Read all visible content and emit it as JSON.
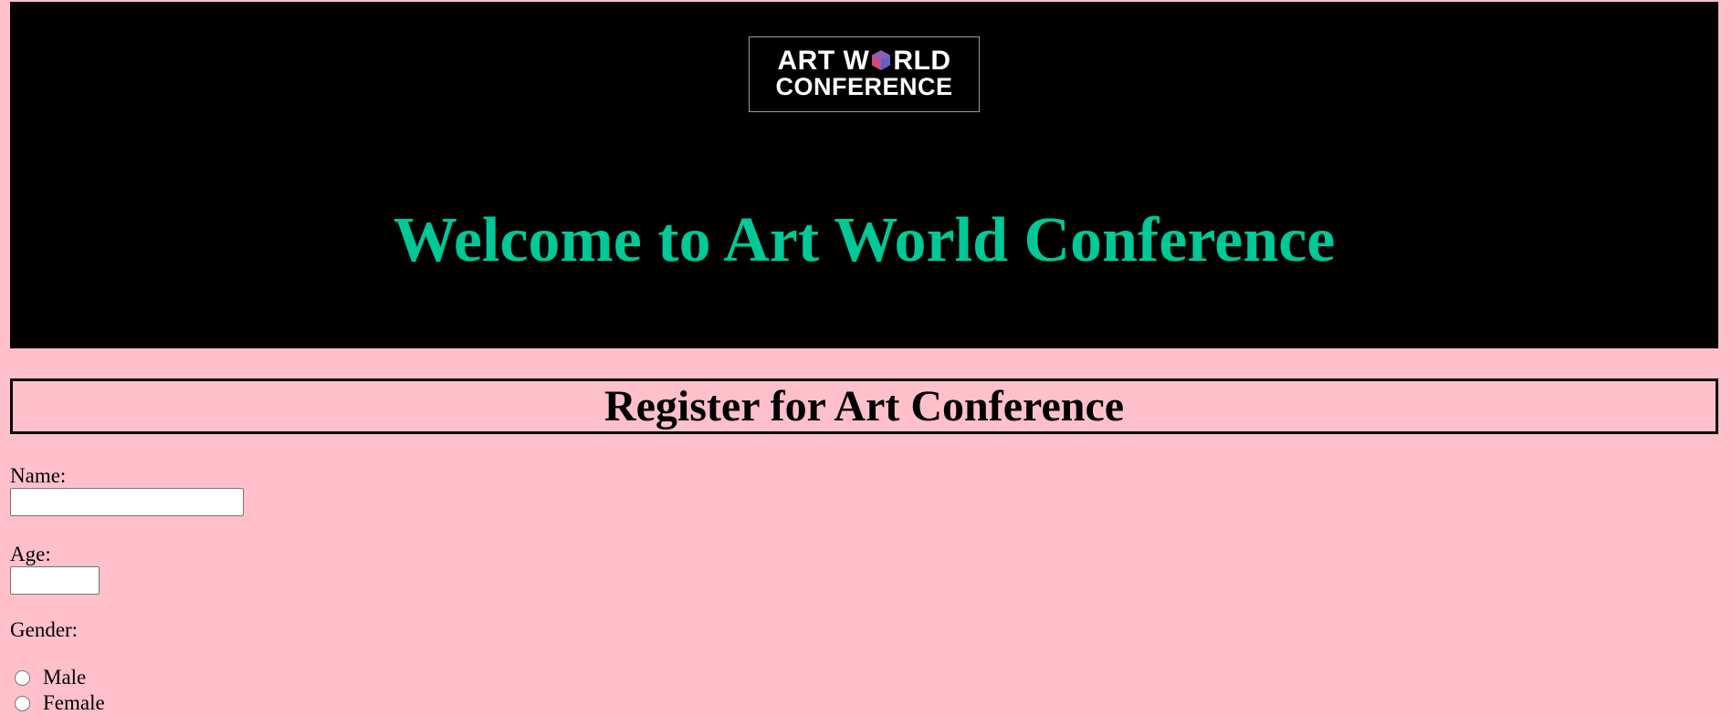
{
  "header": {
    "logo": {
      "line1_left": "ART W",
      "line1_right": "RLD",
      "line2": "CONFERENCE",
      "icon": "hexagon-logo-icon",
      "colors": {
        "hex_left": "#d04b7a",
        "hex_right": "#5c63c9",
        "hex_top": "#8d5fb2"
      }
    },
    "welcome_title": "Welcome to Art World Conference"
  },
  "form": {
    "title": "Register for Art Conference",
    "name": {
      "label": "Name:",
      "value": "",
      "placeholder": ""
    },
    "age": {
      "label": "Age:",
      "value": "",
      "placeholder": ""
    },
    "gender": {
      "label": "Gender:",
      "options": [
        "Male",
        "Female"
      ]
    }
  },
  "colors": {
    "page_background": "#ffc0cb",
    "header_background": "#000000",
    "welcome_text": "#00c896"
  }
}
